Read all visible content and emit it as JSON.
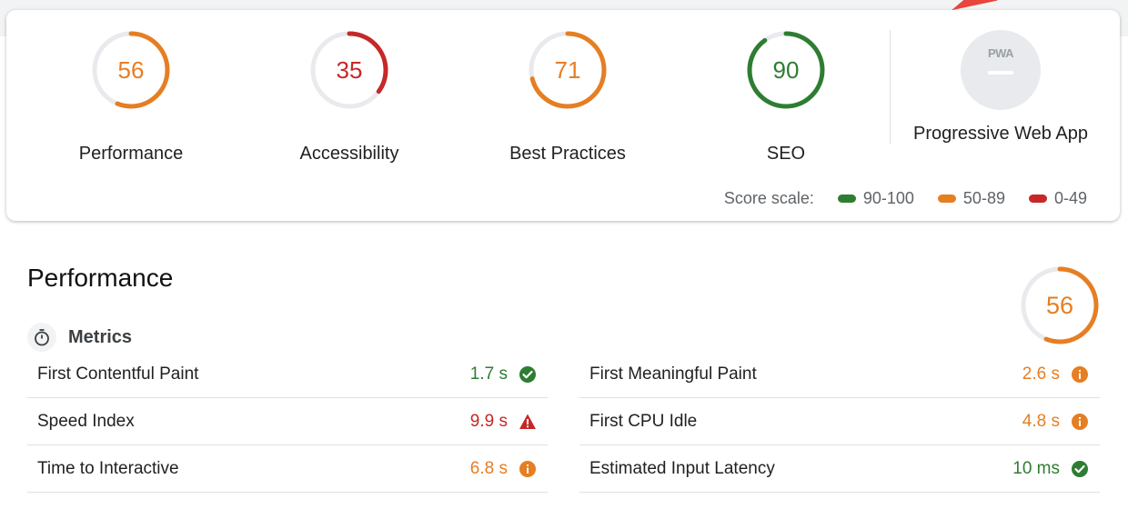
{
  "colors": {
    "pass": "#2e7d32",
    "average": "#e67e22",
    "fail": "#c62828",
    "track": "#e8eaed"
  },
  "categories": [
    {
      "label": "Performance",
      "score": "56",
      "status": "average",
      "fraction": 0.56
    },
    {
      "label": "Accessibility",
      "score": "35",
      "status": "fail",
      "fraction": 0.35
    },
    {
      "label": "Best Practices",
      "score": "71",
      "status": "average",
      "fraction": 0.71
    },
    {
      "label": "SEO",
      "score": "90",
      "status": "pass",
      "fraction": 0.9
    }
  ],
  "pwa": {
    "badge_text": "PWA",
    "label": "Progressive Web App"
  },
  "scale": {
    "label": "Score scale:",
    "ranges": [
      {
        "range": "90-100",
        "status": "pass"
      },
      {
        "range": "50-89",
        "status": "average"
      },
      {
        "range": "0-49",
        "status": "fail"
      }
    ]
  },
  "performance": {
    "title": "Performance",
    "score": "56",
    "fraction": 0.56,
    "metrics_title": "Metrics",
    "metrics_icon": "stopwatch-icon",
    "left_metrics": [
      {
        "name": "First Contentful Paint",
        "value": "1.7 s",
        "status": "pass",
        "icon": "check-circle-icon"
      },
      {
        "name": "Speed Index",
        "value": "9.9 s",
        "status": "fail",
        "icon": "warning-triangle-icon"
      },
      {
        "name": "Time to Interactive",
        "value": "6.8 s",
        "status": "average",
        "icon": "info-circle-icon"
      }
    ],
    "right_metrics": [
      {
        "name": "First Meaningful Paint",
        "value": "2.6 s",
        "status": "average",
        "icon": "info-circle-icon"
      },
      {
        "name": "First CPU Idle",
        "value": "4.8 s",
        "status": "average",
        "icon": "info-circle-icon"
      },
      {
        "name": "Estimated Input Latency",
        "value": "10 ms",
        "status": "pass",
        "icon": "check-circle-icon"
      }
    ]
  }
}
